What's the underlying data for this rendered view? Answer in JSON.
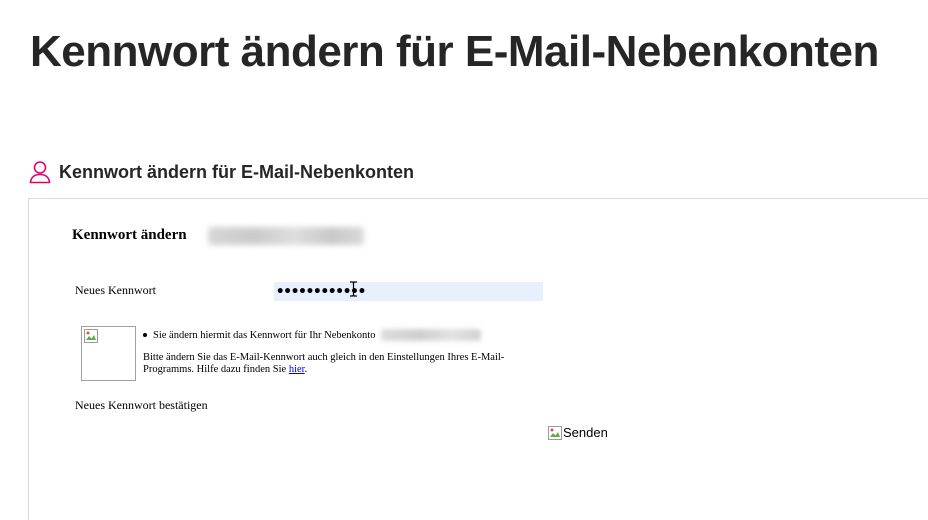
{
  "page": {
    "title": "Kennwort ändern für E-Mail-Nebenkonten"
  },
  "section": {
    "title": "Kennwort ändern für E-Mail-Nebenkonten",
    "icon": "user-icon",
    "icon_color": "#e20074"
  },
  "form": {
    "heading": "Kennwort ändern",
    "new_password_label": "Neues Kennwort",
    "new_password_value": "••••••••••••",
    "confirm_password_label": "Neues Kennwort bestätigen",
    "hint_bullet": "Sie ändern hiermit das Kennwort für Ihr Nebenkonto",
    "hint_text_before_link": "Bitte ändern Sie das E-Mail-Kennwort auch gleich in den Einstellungen Ihres E-Mail-Programms. Hilfe dazu finden Sie ",
    "hint_link": "hier",
    "hint_text_after_link": ".",
    "submit_alt": "Senden"
  },
  "colors": {
    "input_background": "#e8f0fe",
    "link": "#0000ee",
    "panel_border": "#d8d8d8"
  }
}
